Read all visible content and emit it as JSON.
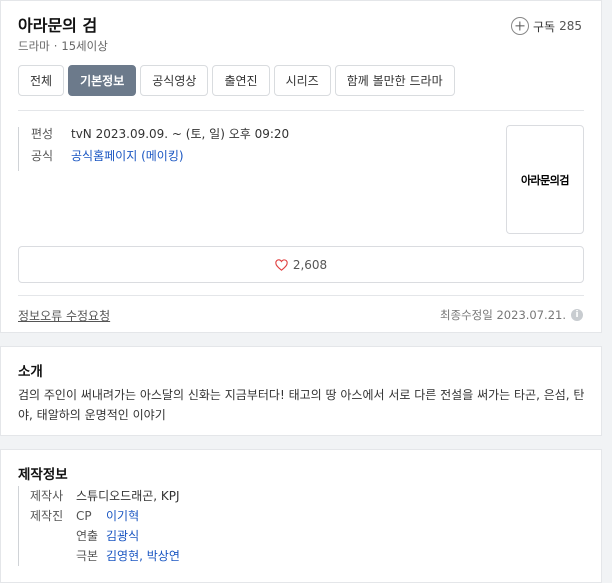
{
  "header": {
    "title": "아라문의 검",
    "genre": "드라마",
    "separator": "·",
    "rating": "15세이상",
    "subscribe_label": "구독",
    "subscribe_count": "285"
  },
  "tabs": [
    {
      "label": "전체",
      "active": false
    },
    {
      "label": "기본정보",
      "active": true
    },
    {
      "label": "공식영상",
      "active": false
    },
    {
      "label": "출연진",
      "active": false
    },
    {
      "label": "시리즈",
      "active": false
    },
    {
      "label": "함께 볼만한 드라마",
      "active": false
    }
  ],
  "info": {
    "broadcast_label": "편성",
    "broadcast_value": "tvN  2023.09.09. ~  (토, 일) 오후 09:20",
    "official_label": "공식",
    "official_link_homepage": "공식홈페이지",
    "official_link_making": "(메이킹)"
  },
  "poster": {
    "logo_text": "아라문의검"
  },
  "like": {
    "count": "2,608",
    "icon": "heart-icon"
  },
  "footer": {
    "report_label": "정보오류 수정요청",
    "updated_text": "최종수정일 2023.07.21.",
    "info_icon_glyph": "i"
  },
  "intro": {
    "title": "소개",
    "text": "검의 주인이 써내려가는 아스달의 신화는 지금부터다! 태고의 땅 아스에서 서로 다른 전설을 써가는 타곤, 은섬, 탄야, 태알하의 운명적인 이야기"
  },
  "production": {
    "title": "제작정보",
    "studio_label": "제작사",
    "studio_value": "스튜디오드래곤, KPJ",
    "crew_label": "제작진",
    "cp_label": "CP",
    "cp_value": "이기혁",
    "director_label": "연출",
    "director_value": "김광식",
    "writer_label": "극본",
    "writer_value": "김영현, 박상연"
  }
}
